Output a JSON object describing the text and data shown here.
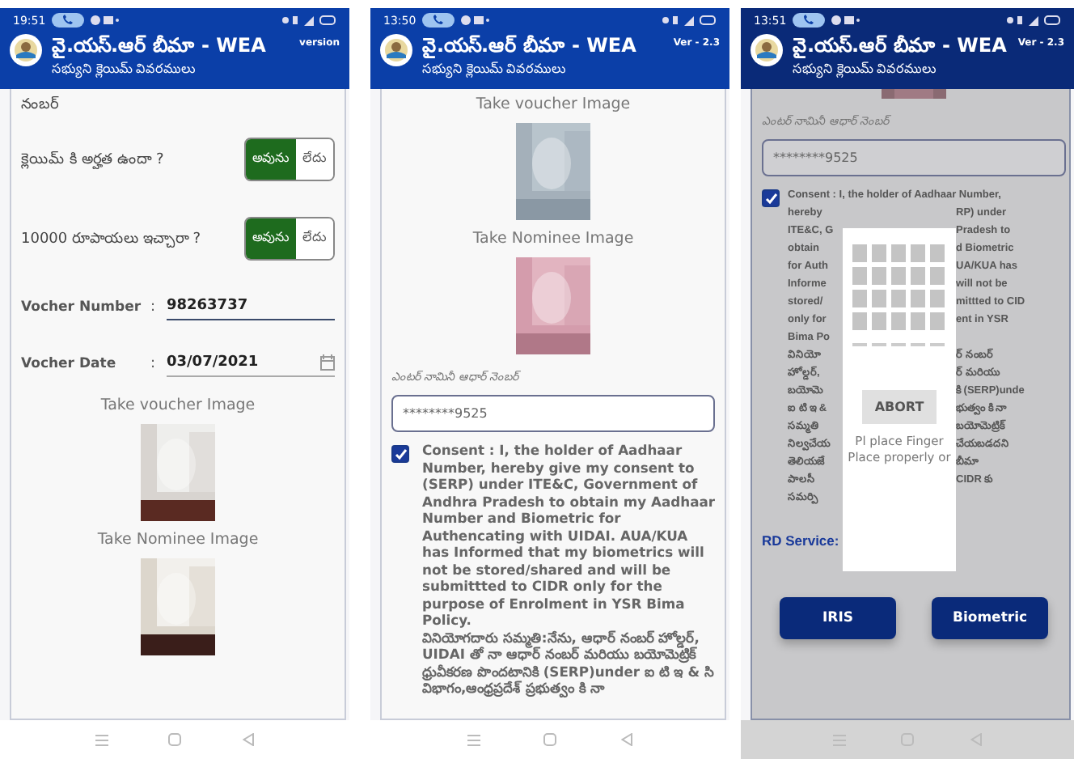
{
  "phones": [
    {
      "status_time": "19:51",
      "dimmed": false,
      "header": {
        "title": "వై.యస్.ఆర్ బీమా - WEA",
        "subtitle": "సభ్యుని క్లెయిమ్ వివరములు",
        "version": "version"
      },
      "content": [
        {
          "kind": "text",
          "text": "నంబర్"
        },
        {
          "kind": "question",
          "label": "క్లెయిమ్ కి అర్హత ఉందా ?",
          "options": [
            {
              "label": "అవును",
              "selected": true
            },
            {
              "label": "లేదు",
              "selected": false
            }
          ]
        },
        {
          "kind": "question",
          "label": "10000 రూపాయలు ఇచ్చారా ?",
          "options": [
            {
              "label": "అవును",
              "selected": true
            },
            {
              "label": "లేదు",
              "selected": false
            }
          ]
        },
        {
          "kind": "field",
          "label": "Vocher Number",
          "separator": ":",
          "value": "98263737"
        },
        {
          "kind": "date",
          "label": "Vocher Date",
          "separator": ":",
          "value": "03/07/2021"
        },
        {
          "kind": "caption",
          "text": "Take voucher Image"
        },
        {
          "kind": "picture"
        },
        {
          "kind": "caption",
          "text": "Take Nominee Image"
        },
        {
          "kind": "picture"
        }
      ]
    },
    {
      "status_time": "13:50",
      "dimmed": false,
      "header": {
        "title": "వై.యస్.ఆర్ బీమా - WEA",
        "subtitle": "సభ్యుని క్లెయిమ్ వివరములు",
        "version": "Ver - 2.3"
      },
      "content": [
        {
          "kind": "caption",
          "text": "Take voucher Image"
        },
        {
          "kind": "picture"
        },
        {
          "kind": "caption",
          "text": "Take Nominee Image"
        },
        {
          "kind": "picture"
        },
        {
          "kind": "input",
          "label": "ఎంటర్ నామినీ ఆధార్ నెంబర్",
          "value": "********9525"
        },
        {
          "kind": "consent",
          "checked": true,
          "text": "Consent : I, the holder of Aadhaar Number, hereby give my consent to (SERP) under ITE&C, Government of Andhra Pradesh to obtain my Aadhaar Number and Biometric for Authencating with UIDAI. AUA/KUA has Informed that my biometrics will not be stored/shared and will be submittted to CIDR only for the purpose of Enrolment in YSR Bima Policy.",
          "text_te": "వినియోగదారు సమ్మతి:నేను, ఆధార్ నంబర్ హోల్డర్, UIDAI తో నా ఆధార్ నంబర్ మరియు బయోమెట్రిక్ ధ్రువీకరణ పొందటానికి (SERP)under ఐ టి ఇ & సి విభాగం,ఆంధ్రప్రదేశ్ ప్రభుత్వం కి నా"
        }
      ]
    },
    {
      "status_time": "13:51",
      "dimmed": true,
      "header": {
        "title": "వై.యస్.ఆర్ బీమా - WEA",
        "subtitle": "సభ్యుని క్లెయిమ్ వివరములు",
        "version": "Ver - 2.3"
      },
      "content": [
        {
          "kind": "picture_edge"
        },
        {
          "kind": "input",
          "label": "ఎంటర్ నామినీ ఆధార్ నెంబర్",
          "value": "********9525"
        },
        {
          "kind": "consent_lines",
          "checked": true,
          "lines": [
            {
              "left": "Consent : I, the holder of Aadhaar Number,"
            },
            {
              "left": "hereby",
              "right": "RP) under"
            },
            {
              "left": "ITE&C, G",
              "right": "Pradesh to"
            },
            {
              "left": "obtain",
              "right": "d Biometric"
            },
            {
              "left": "for Auth",
              "right": "UA/KUA has"
            },
            {
              "left": "Informe",
              "right": "will not be"
            },
            {
              "left": "stored/",
              "right": "mittted to CID"
            },
            {
              "left": "only for",
              "right": "ent in YSR"
            },
            {
              "left": "Bima Po"
            },
            {
              "left": "వినియో",
              "right": "ర్ నంబర్"
            },
            {
              "left": "హోల్డర్,",
              "right": "ర్ మరియు"
            },
            {
              "left": "బయోమె",
              "right": "కి (SERP)unde"
            },
            {
              "left": "ఐ టి ఇ &",
              "right": "భుత్వం కి నా"
            },
            {
              "left": "సమ్మతి",
              "right": "బయోమెట్రిక్"
            },
            {
              "left": "నిల్వచేయ",
              "right": "చేయబడదని"
            },
            {
              "left": "తెలియజే",
              "right": "బీమా"
            },
            {
              "left": "పాలసీ",
              "right": "CIDR కు"
            },
            {
              "left": "సమర్పి"
            }
          ]
        },
        {
          "kind": "section",
          "text": "RD Service:"
        },
        {
          "kind": "buttons",
          "buttons": [
            "IRIS",
            "Biometric"
          ]
        }
      ],
      "dialog": {
        "action": "ABORT",
        "message": [
          "Pl place Finger",
          "Place properly or"
        ]
      }
    }
  ]
}
